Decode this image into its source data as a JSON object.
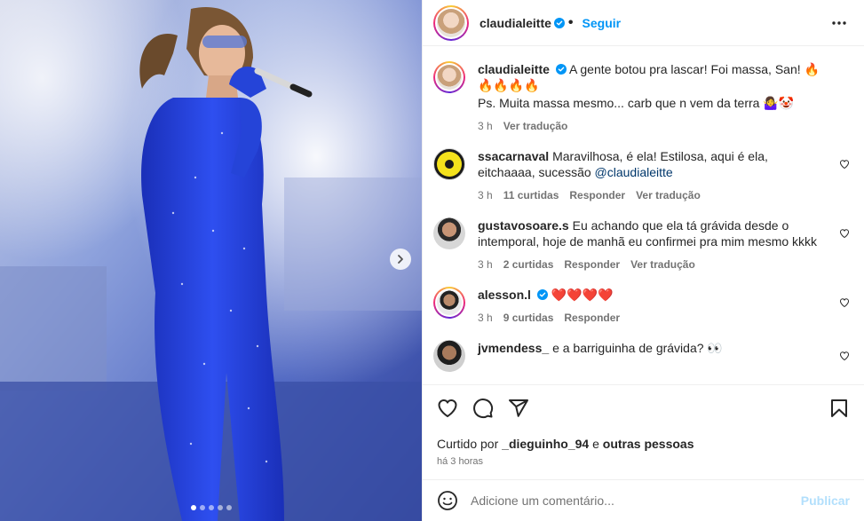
{
  "post": {
    "author": "claudialeitte",
    "follow_label": "Seguir",
    "caption_line1": "A gente botou pra lascar! Foi massa, San! 🔥🔥🔥🔥🔥",
    "caption_line2": "Ps. Muita massa mesmo... carb que n vem da terra 🤷‍♀️🤡",
    "caption_time": "3 h",
    "caption_translate": "Ver tradução",
    "carousel_slides": 5,
    "carousel_active": 1
  },
  "comments": [
    {
      "user": "ssacarnaval",
      "text": "Maravilhosa, é ela! Estilosa, aqui é ela, eitchaaaa, sucessão ",
      "mention": "@claudialeitte",
      "time": "3 h",
      "likes": "11 curtidas",
      "reply": "Responder",
      "translate": "Ver tradução"
    },
    {
      "user": "gustavosoare.s",
      "text": "Eu achando que ela tá grávida desde o intemporal, hoje de manhã eu confirmei pra mim mesmo kkkk",
      "time": "3 h",
      "likes": "2 curtidas",
      "reply": "Responder",
      "translate": "Ver tradução"
    },
    {
      "user": "alesson.l",
      "text": "❤️❤️❤️❤️",
      "time": "3 h",
      "likes": "9 curtidas",
      "reply": "Responder"
    },
    {
      "user": "jvmendess_",
      "text": "e a barriguinha de grávida? 👀"
    }
  ],
  "likes": {
    "prefix": "Curtido por ",
    "user": "_dieguinho_94",
    "middle": " e ",
    "suffix": "outras pessoas"
  },
  "timestamp": "há 3 horas",
  "add_comment": {
    "placeholder": "Adicione um comentário...",
    "publish_label": "Publicar"
  },
  "colors": {
    "accent": "#0095f6",
    "outfit": "#1f3fd6",
    "heart": "#ed4956"
  }
}
